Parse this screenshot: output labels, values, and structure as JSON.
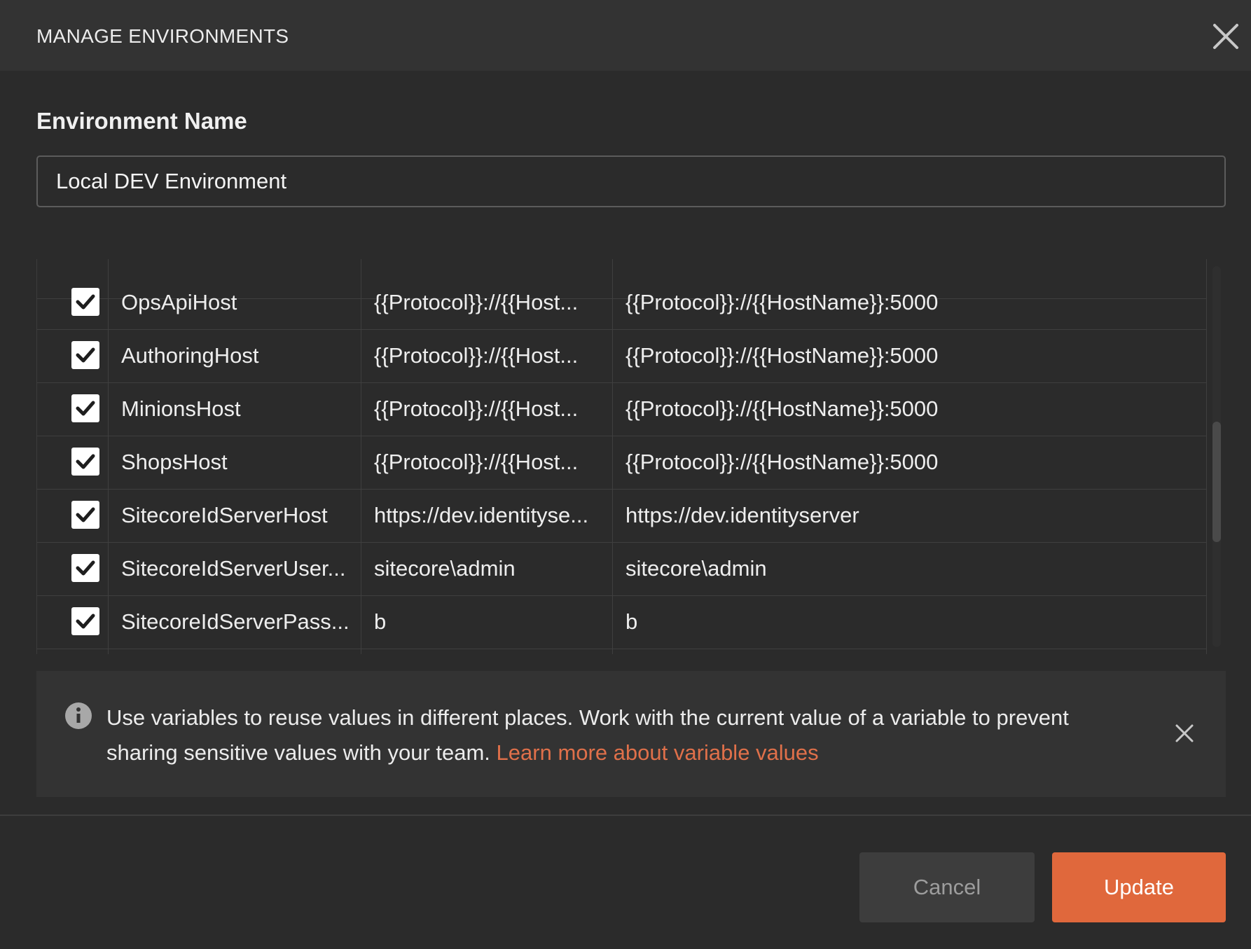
{
  "header": {
    "title": "MANAGE ENVIRONMENTS",
    "close_icon": "close-icon"
  },
  "environment": {
    "label": "Environment Name",
    "value": "Local DEV Environment"
  },
  "variables": [
    {
      "checked": true,
      "name": "OpsApiHost",
      "initial": "{{Protocol}}://{{Host...",
      "current": "{{Protocol}}://{{HostName}}:5000"
    },
    {
      "checked": true,
      "name": "AuthoringHost",
      "initial": "{{Protocol}}://{{Host...",
      "current": "{{Protocol}}://{{HostName}}:5000"
    },
    {
      "checked": true,
      "name": "MinionsHost",
      "initial": "{{Protocol}}://{{Host...",
      "current": "{{Protocol}}://{{HostName}}:5000"
    },
    {
      "checked": true,
      "name": "ShopsHost",
      "initial": "{{Protocol}}://{{Host...",
      "current": "{{Protocol}}://{{HostName}}:5000"
    },
    {
      "checked": true,
      "name": "SitecoreIdServerHost",
      "initial": "https://dev.identityse...",
      "current": "https://dev.identityserver"
    },
    {
      "checked": true,
      "name": "SitecoreIdServerUser...",
      "initial": "sitecore\\admin",
      "current": "sitecore\\admin"
    },
    {
      "checked": true,
      "name": "SitecoreIdServerPass...",
      "initial": "b",
      "current": "b"
    }
  ],
  "info": {
    "text": "Use variables to reuse values in different places. Work with the current value of a variable to prevent sharing sensitive values with your team.",
    "link": "Learn more about variable values",
    "icon": "info-icon"
  },
  "footer": {
    "cancel_label": "Cancel",
    "update_label": "Update"
  },
  "colors": {
    "accent": "#e0683c",
    "link": "#e0704a",
    "background": "#2b2b2b"
  }
}
